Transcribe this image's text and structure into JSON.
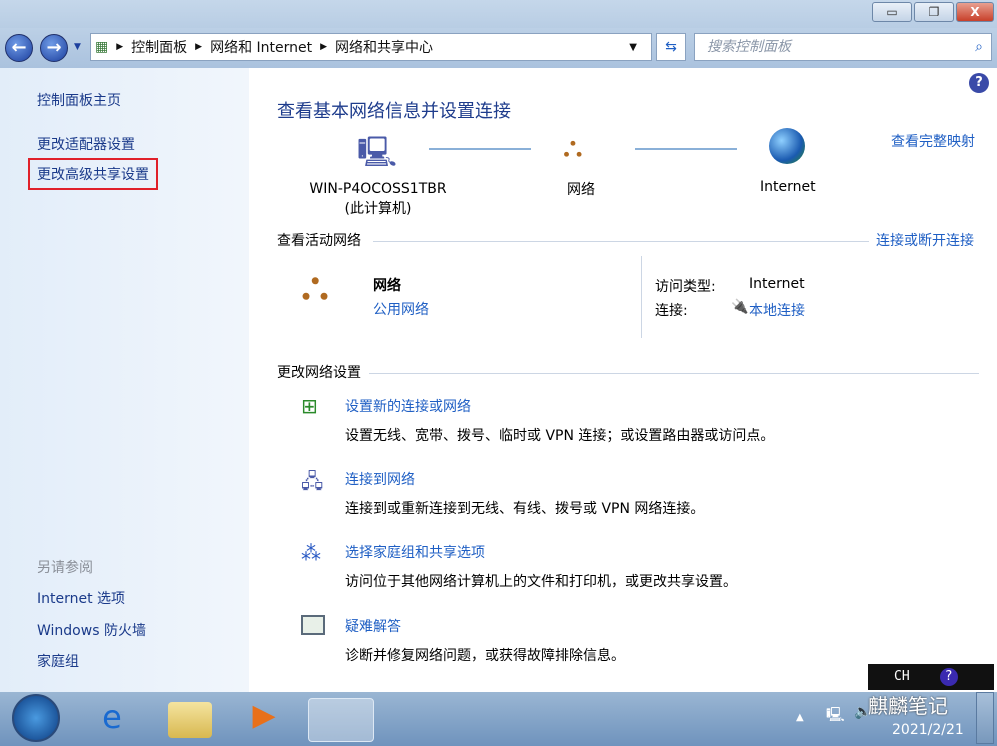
{
  "window": {
    "minimize": "▭",
    "restore": "❐",
    "close": "X"
  },
  "nav": {
    "breadcrumb": [
      "控制面板",
      "网络和 Internet",
      "网络和共享中心"
    ],
    "search_placeholder": "搜索控制面板"
  },
  "sidebar": {
    "items": [
      "控制面板主页",
      "更改适配器设置",
      "更改高级共享设置"
    ],
    "see_also_title": "另请参阅",
    "see_also": [
      "Internet 选项",
      "Windows 防火墙",
      "家庭组"
    ],
    "highlight_color": "#e0202a"
  },
  "main": {
    "title": "查看基本网络信息并设置连接",
    "full_map": "查看完整映射",
    "map": {
      "computer": "WIN-P4OCOSS1TBR",
      "computer_sub": "(此计算机)",
      "network": "网络",
      "internet": "Internet"
    },
    "active_title": "查看活动网络",
    "connect_link": "连接或断开连接",
    "net_name": "网络",
    "net_type": "公用网络",
    "access_label": "访问类型:",
    "access_value": "Internet",
    "conn_label": "连接:",
    "conn_value": "本地连接",
    "change_title": "更改网络设置",
    "tasks": [
      {
        "title": "设置新的连接或网络",
        "desc": "设置无线、宽带、拨号、临时或 VPN 连接；或设置路由器或访问点。"
      },
      {
        "title": "连接到网络",
        "desc": "连接到或重新连接到无线、有线、拨号或 VPN 网络连接。"
      },
      {
        "title": "选择家庭组和共享选项",
        "desc": "访问位于其他网络计算机上的文件和打印机，或更改共享设置。"
      },
      {
        "title": "疑难解答",
        "desc": "诊断并修复网络问题，或获得故障排除信息。"
      }
    ]
  },
  "tray": {
    "lang": "CH",
    "date": "2021/2/21",
    "watermark": "麒麟笔记"
  }
}
